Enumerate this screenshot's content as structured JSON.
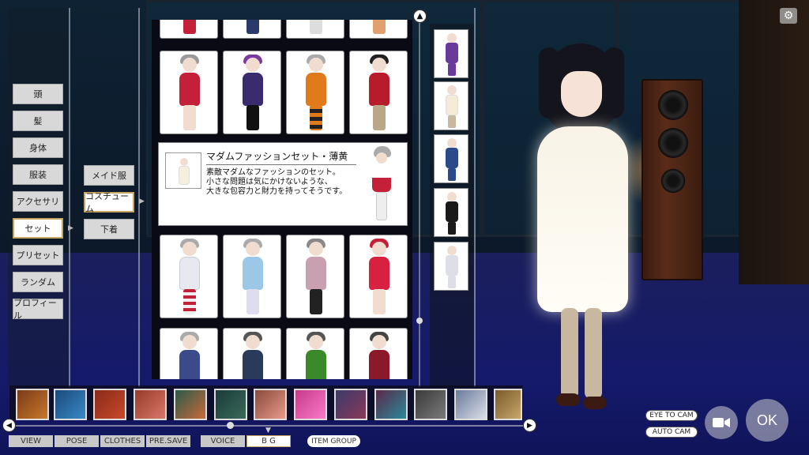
{
  "left_menu": {
    "items": [
      {
        "label": "頭",
        "active": false
      },
      {
        "label": "髪",
        "active": false
      },
      {
        "label": "身体",
        "active": false
      },
      {
        "label": "服装",
        "active": false
      },
      {
        "label": "アクセサリ",
        "active": false
      },
      {
        "label": "セット",
        "active": true
      },
      {
        "label": "プリセット",
        "active": false
      },
      {
        "label": "ランダム",
        "active": false
      },
      {
        "label": "プロフィール",
        "active": false
      }
    ]
  },
  "sub_menu": {
    "items": [
      {
        "label": "メイド服",
        "active": false
      },
      {
        "label": "コスチューム",
        "active": true
      },
      {
        "label": "下着",
        "active": false
      }
    ]
  },
  "tooltip": {
    "title": "マダムファッションセット・薄黄",
    "desc_line1": "素敵マダムなファッションのセット。",
    "desc_line2": "小さな問題は気にかけないような、",
    "desc_line3": "大きな包容力と財力を持ってそうです。"
  },
  "costume_colors": {
    "row1": [
      "#c4203a",
      "#3a2a6e",
      "#e07a1a",
      "#b81c2c"
    ],
    "row3": [
      "#e8e8f0",
      "#9cc8e8",
      "#c8a0b0",
      "#d82040"
    ],
    "row4": [
      "#3a4a8a",
      "#2a3a5a",
      "#3a8a2a",
      "#8a1a2a"
    ]
  },
  "strip_colors": [
    "#6a3a9a",
    "#f4ecd6",
    "#2a4a8a",
    "#1a1a1a",
    "#dedee6"
  ],
  "bg_thumbs": [
    "#7a3a1a",
    "#1a4a7a",
    "#8a2a1a",
    "#9a3a2a",
    "#2a5a4a",
    "#1a3a3a",
    "#8a4a3a",
    "#c83a8a",
    "#3a3a6a",
    "#5a2a4a",
    "#3a3a3a",
    "#6a7a9a",
    "#7a5a2a"
  ],
  "bottom_tabs": {
    "view": "VIEW",
    "pose": "POSE",
    "clothes": "CLOTHES",
    "pre_save": "PRE.SAVE",
    "voice": "VOICE",
    "bg": "B G",
    "item_group": "ITEM GROUP"
  },
  "camera": {
    "eye_to_cam": "EYE TO CAM",
    "auto_cam": "AUTO CAM"
  },
  "ok_label": "OK",
  "icons": {
    "scroll_up": "▲",
    "scroll_left": "◀",
    "scroll_right": "▶",
    "settings": "⚙",
    "video": "video-camera"
  }
}
